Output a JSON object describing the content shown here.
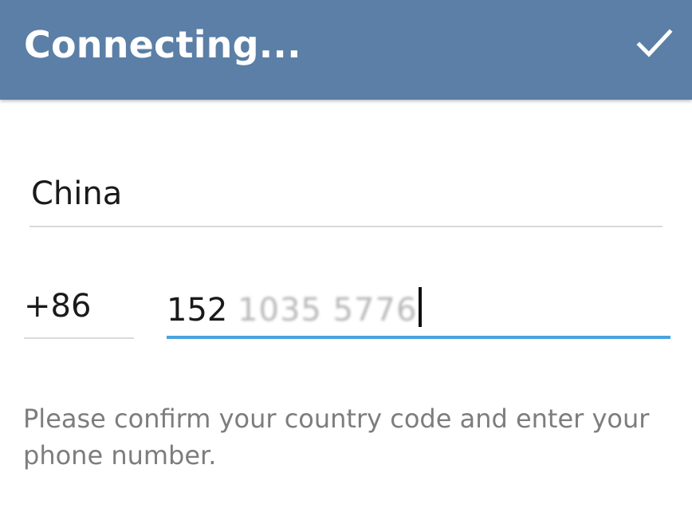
{
  "actionbar": {
    "title": "Connecting...",
    "done_icon": "checkmark-icon",
    "background_color": "#5b7fa6"
  },
  "country": {
    "value": "China"
  },
  "phone": {
    "country_code": "+86",
    "number_prefix": "152",
    "number_rest_obscured": "1035 5776",
    "accent_color": "#4aa3df"
  },
  "hint": {
    "text": "Please confirm your country code and enter your phone number."
  }
}
